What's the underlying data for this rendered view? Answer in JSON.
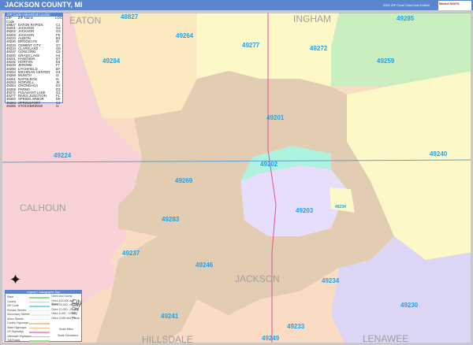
{
  "header": {
    "title": "JACKSON COUNTY, MI",
    "edition": "2022 ZIP Code ColorCast Edition",
    "logo": "Market MAPS"
  },
  "counties": [
    "EATON",
    "INGHAM",
    "CALHOUN",
    "JACKSON",
    "HILLSDALE",
    "LENAWEE"
  ],
  "zip_labels": [
    "48827",
    "49285",
    "49264",
    "49277",
    "49272",
    "49259",
    "49284",
    "49201",
    "49224",
    "49202",
    "49240",
    "49269",
    "49203",
    "49234",
    "49283",
    "49237",
    "49246",
    "49234",
    "49241",
    "49230",
    "49233",
    "49249"
  ],
  "index": {
    "title": "ZIP Code Index/Grid Locator",
    "headers": [
      "ZIP Code",
      "ZIP Name",
      "LOC"
    ],
    "rows": [
      [
        "48827",
        "EATON RAPIDS",
        "C1"
      ],
      [
        "49201",
        "JACKSON",
        "G4"
      ],
      [
        "49202",
        "JACKSON",
        "G4"
      ],
      [
        "49203",
        "JACKSON",
        "F5"
      ],
      [
        "49224",
        "ALBION",
        "B3"
      ],
      [
        "49230",
        "BROOKLYN",
        "I8"
      ],
      [
        "49233",
        "CEMENT CITY",
        "G7"
      ],
      [
        "49234",
        "CLARKLAKE",
        "G6"
      ],
      [
        "49237",
        "CONCORD",
        "C5"
      ],
      [
        "49240",
        "GRASS LAKE",
        "H4"
      ],
      [
        "49241",
        "HANOVER",
        "D7"
      ],
      [
        "49246",
        "HORTON",
        "E6"
      ],
      [
        "49249",
        "JEROME",
        "F7"
      ],
      [
        "49250",
        "LITCHFIELD",
        "B7"
      ],
      [
        "49254",
        "MICHIGAN CENTER",
        "H4"
      ],
      [
        "49259",
        "MUNITH",
        "I2"
      ],
      [
        "49261",
        "NAPOLEON",
        "I5"
      ],
      [
        "49263",
        "NORVELL",
        "J6"
      ],
      [
        "49264",
        "ONONDAGA",
        "D1"
      ],
      [
        "49269",
        "PARMA",
        "D3"
      ],
      [
        "49272",
        "PLEASANT LAKE",
        "G1"
      ],
      [
        "49277",
        "RIVES JUNCTION",
        "F1"
      ],
      [
        "49283",
        "SPRING ARBOR",
        "D5"
      ],
      [
        "49284",
        "SPRINGPORT",
        "C2"
      ],
      [
        "49285",
        "STOCKBRIDGE",
        "I1"
      ]
    ]
  },
  "legend": {
    "title": "Legend / Cartographic Key",
    "items": [
      "State",
      "County",
      "ZIP Code",
      "Primary Streets",
      "Secondary Streets",
      "Minor Streets",
      "County Highways",
      "State Highways",
      "US Highways",
      "Interstate Highways",
      "Toll Roads"
    ],
    "cities": [
      "Cities and Towns",
      "Cities 100,000 and Above",
      "Cities 25,000 - 99,999",
      "Cities 10,000 - 24,999",
      "Cities 5,000 - 9,999",
      "Cities 4,999 and Below"
    ],
    "city_word": "City",
    "scale_miles": "Scale Miles",
    "scale_km": "Scale Kilometers"
  },
  "colors": {
    "header": "#5b86cf",
    "zip": "#1fa3e8"
  }
}
